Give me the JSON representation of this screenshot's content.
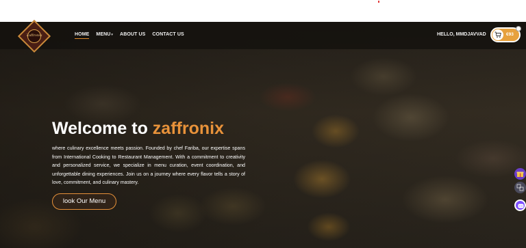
{
  "nav": {
    "logo_text": "Zaffronix",
    "links": [
      {
        "label": "HOME",
        "active": true
      },
      {
        "label": "MENU",
        "has_dropdown": true
      },
      {
        "label": "ABOUT US"
      },
      {
        "label": "CONTACT US"
      }
    ],
    "greeting": "HELLO, MMDJAVVAD",
    "cart_amount": "€93",
    "cart_icon": "cart-icon"
  },
  "hero": {
    "title_prefix": "Welcome to ",
    "title_brand": "zaffronix",
    "description": "where culinary excellence meets passion. Founded by chef Fariba, our expertise spans from International Cooking to Restaurant Management. With a commitment to creativity and personalized service, we specialize in menu curation, event coordination, and unforgettable dining experiences. Join us on a journey where every flavor tells a story of love, commitment, and culinary mastery.",
    "cta_label": "look Our Menu"
  },
  "colors": {
    "accent": "#e8923a",
    "cart": "#e7a13d",
    "nav_bg": "#14110e"
  },
  "side_widgets": [
    "gift-icon",
    "translate-icon",
    "chat-bot-icon"
  ]
}
